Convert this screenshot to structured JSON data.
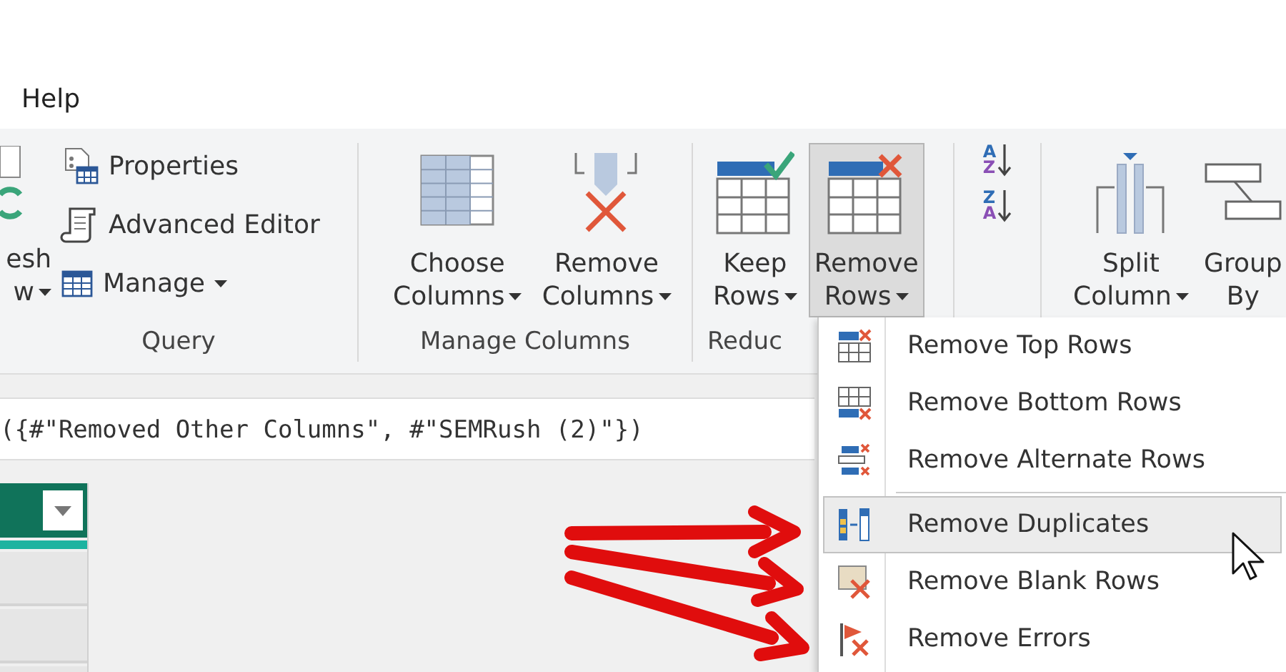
{
  "ribbon_tab": {
    "label": "Help"
  },
  "ribbon": {
    "groups": [
      {
        "label": "Query",
        "items": [
          {
            "kind": "large",
            "lines": [
              "esh",
              "w"
            ],
            "dropdown": true,
            "pressed": false
          },
          {
            "kind": "stack",
            "buttons": [
              {
                "label": "Properties",
                "dropdown": false
              },
              {
                "label": "Advanced Editor",
                "dropdown": false
              },
              {
                "label": "Manage",
                "dropdown": true
              }
            ]
          }
        ]
      },
      {
        "label": "Manage Columns",
        "items": [
          {
            "kind": "large",
            "lines": [
              "Choose",
              "Columns"
            ],
            "dropdown": true,
            "pressed": false
          },
          {
            "kind": "large",
            "lines": [
              "Remove",
              "Columns"
            ],
            "dropdown": true,
            "pressed": false
          }
        ]
      },
      {
        "label": "Reduc",
        "items": [
          {
            "kind": "large",
            "lines": [
              "Keep",
              "Rows"
            ],
            "dropdown": true,
            "pressed": false
          },
          {
            "kind": "large",
            "lines": [
              "Remove",
              "Rows"
            ],
            "dropdown": true,
            "pressed": true
          }
        ]
      },
      {
        "items": [
          {
            "kind": "sort",
            "letters": [
              "A",
              "Z"
            ]
          },
          {
            "kind": "sort",
            "letters": [
              "Z",
              "A"
            ]
          }
        ]
      },
      {
        "items": [
          {
            "kind": "large",
            "lines": [
              "Split",
              "Column"
            ],
            "dropdown": true,
            "pressed": false
          },
          {
            "kind": "large",
            "lines": [
              "Group",
              "By"
            ],
            "dropdown": false,
            "pressed": false
          }
        ]
      }
    ]
  },
  "formula_bar": {
    "text": "({#\"Removed Other Columns\", #\"SEMRush (2)\"})"
  },
  "menu": {
    "sections": [
      [
        {
          "label": "Remove Top Rows",
          "selected": false
        },
        {
          "label": "Remove Bottom Rows",
          "selected": false
        },
        {
          "label": "Remove Alternate Rows",
          "selected": false
        }
      ],
      [
        {
          "label": "Remove Duplicates",
          "selected": true
        },
        {
          "label": "Remove Blank Rows",
          "selected": false
        },
        {
          "label": "Remove Errors",
          "selected": false
        }
      ]
    ]
  }
}
